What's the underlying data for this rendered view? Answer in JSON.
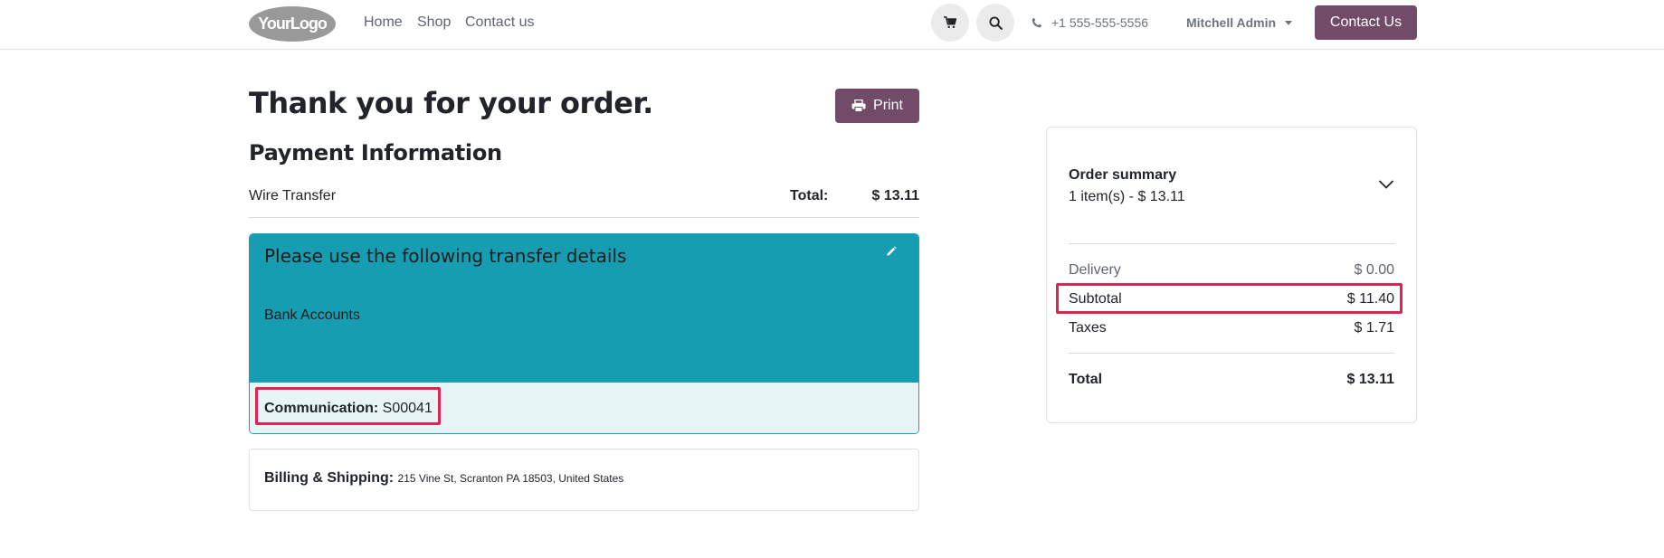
{
  "header": {
    "logo_text": "YourLogo",
    "nav": [
      "Home",
      "Shop",
      "Contact us"
    ],
    "phone": "+1 555-555-5556",
    "user": "Mitchell Admin",
    "contact_button": "Contact Us"
  },
  "main": {
    "title": "Thank you for your order.",
    "print_label": "Print",
    "payment_heading": "Payment Information",
    "payment_method": "Wire Transfer",
    "total_label": "Total:",
    "total_value": "$ 13.11",
    "transfer": {
      "title": "Please use the following transfer details",
      "bank_label": "Bank Accounts",
      "communication_label": "Communication:",
      "communication_value": "S00041"
    },
    "billing": {
      "label": "Billing & Shipping:",
      "address": "215 Vine St, Scranton PA 18503, United States"
    }
  },
  "summary": {
    "title": "Order summary",
    "subtitle": "1 item(s) -  $ 13.11",
    "rows": [
      {
        "label": "Delivery",
        "value": "$ 0.00"
      },
      {
        "label": "Subtotal",
        "value": "$ 11.40"
      },
      {
        "label": "Taxes",
        "value": "$ 1.71"
      }
    ],
    "total_label": "Total",
    "total_value": "$ 13.11"
  },
  "colors": {
    "brand": "#714B67",
    "info": "#179db2",
    "highlight": "#e3224f"
  },
  "icons": [
    "cart-icon",
    "search-icon",
    "phone-icon",
    "printer-icon",
    "pencil-icon",
    "chevron-down-icon"
  ]
}
